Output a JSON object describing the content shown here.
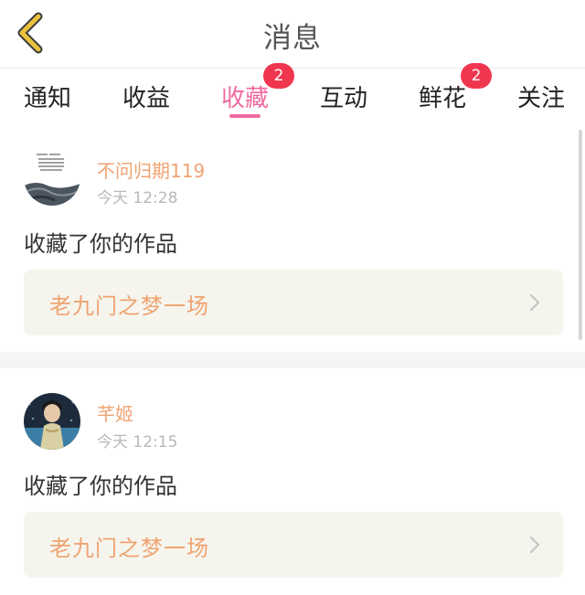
{
  "header": {
    "title": "消息",
    "back_icon": "chevron-left-icon",
    "back_color": "#e9c23e"
  },
  "tabs": [
    {
      "label": "通知",
      "active": false,
      "badge": ""
    },
    {
      "label": "收益",
      "active": false,
      "badge": ""
    },
    {
      "label": "收藏",
      "active": true,
      "badge": "2"
    },
    {
      "label": "互动",
      "active": false,
      "badge": ""
    },
    {
      "label": "鲜花",
      "active": false,
      "badge": "2"
    },
    {
      "label": "关注",
      "active": false,
      "badge": ""
    }
  ],
  "colors": {
    "accent": "#ef6aa0",
    "badge": "#f0364f",
    "username": "#f0a371",
    "work_title": "#f0a371",
    "work_box_bg": "#f5f5ee"
  },
  "messages": [
    {
      "username": "不问归期119",
      "time": "今天 12:28",
      "action": "收藏了你的作品",
      "work_title": "老九门之梦一场",
      "avatar_icon": "user-avatar"
    },
    {
      "username": "芊姬",
      "time": "今天 12:15",
      "action": "收藏了你的作品",
      "work_title": "老九门之梦一场",
      "avatar_icon": "user-avatar"
    }
  ]
}
